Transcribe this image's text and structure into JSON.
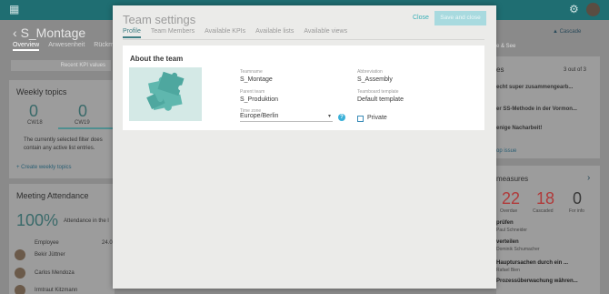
{
  "background": {
    "page_title": "S_Montage",
    "tabs": [
      "Overview",
      "Anwesenheit",
      "Rückm"
    ],
    "button_partial": "Recent KPI values",
    "weekly_topics": {
      "title": "Weekly topics",
      "cw1_value": "0",
      "cw1_label": "CW18",
      "cw2_value": "0",
      "cw2_label": "CW19",
      "empty_text_1": "The currently selected filter does",
      "empty_text_2": "contain any active list entries.",
      "create_link": "+ Create weekly topics"
    },
    "meeting_attendance": {
      "title": "Meeting Attendance",
      "percent": "100%",
      "attendance_text": "Attendance in the l",
      "employee_header": "Employee",
      "employee_value": "24.0",
      "people": [
        "Bekir Jüttner",
        "Carlos Mendoza",
        "Irmtraut Kitzmann"
      ]
    },
    "right_top": {
      "title_partial": "es",
      "count": "3 out of 3",
      "cascade": "Cascade",
      "tabs_partial": "e & See",
      "items": [
        "echt super zusammengearb...",
        "er SS-Methode in der Vormon...",
        "enige Nacharbeit!"
      ],
      "link": "op issue"
    },
    "measures": {
      "title": "measures",
      "overdue_value": "22",
      "overdue_label": "Overdue",
      "cascaded_value": "18",
      "cascaded_label": "Cascaded",
      "info_value": "0",
      "info_label": "For info",
      "rows": [
        {
          "title": "prüfen",
          "person": "Paul Schneider"
        },
        {
          "title": "verteilen",
          "person": "Dominik Schumacher"
        },
        {
          "title": "Hauptursachen durch ein ...",
          "person": "Rafael Bien"
        },
        {
          "title": "Prozessüberwachung währen...",
          "person": ""
        }
      ]
    }
  },
  "modal": {
    "title": "Team settings",
    "close_label": "Close",
    "save_label": "Save and close",
    "tabs": [
      "Profile",
      "Team Members",
      "Available KPIs",
      "Available lists",
      "Available views"
    ],
    "active_tab": "Profile",
    "section_title": "About the team",
    "fields": {
      "teamname_label": "Teamname",
      "teamname_value": "S_Montage",
      "abbreviation_label": "Abbreviation",
      "abbreviation_value": "S_Assembly",
      "parent_team_label": "Parent team",
      "parent_team_value": "S_Produktion",
      "teamboard_template_label": "Teamboard template",
      "teamboard_template_value": "Default template",
      "timezone_label": "Time zone",
      "timezone_value": "Europe/Berlin",
      "private_label": "Private"
    },
    "colors": {
      "accent": "#3ab0b8",
      "tab_active": "#3f7f84",
      "logo_bg": "#d4e9e6",
      "logo_fg": "#5fb7ae"
    }
  }
}
